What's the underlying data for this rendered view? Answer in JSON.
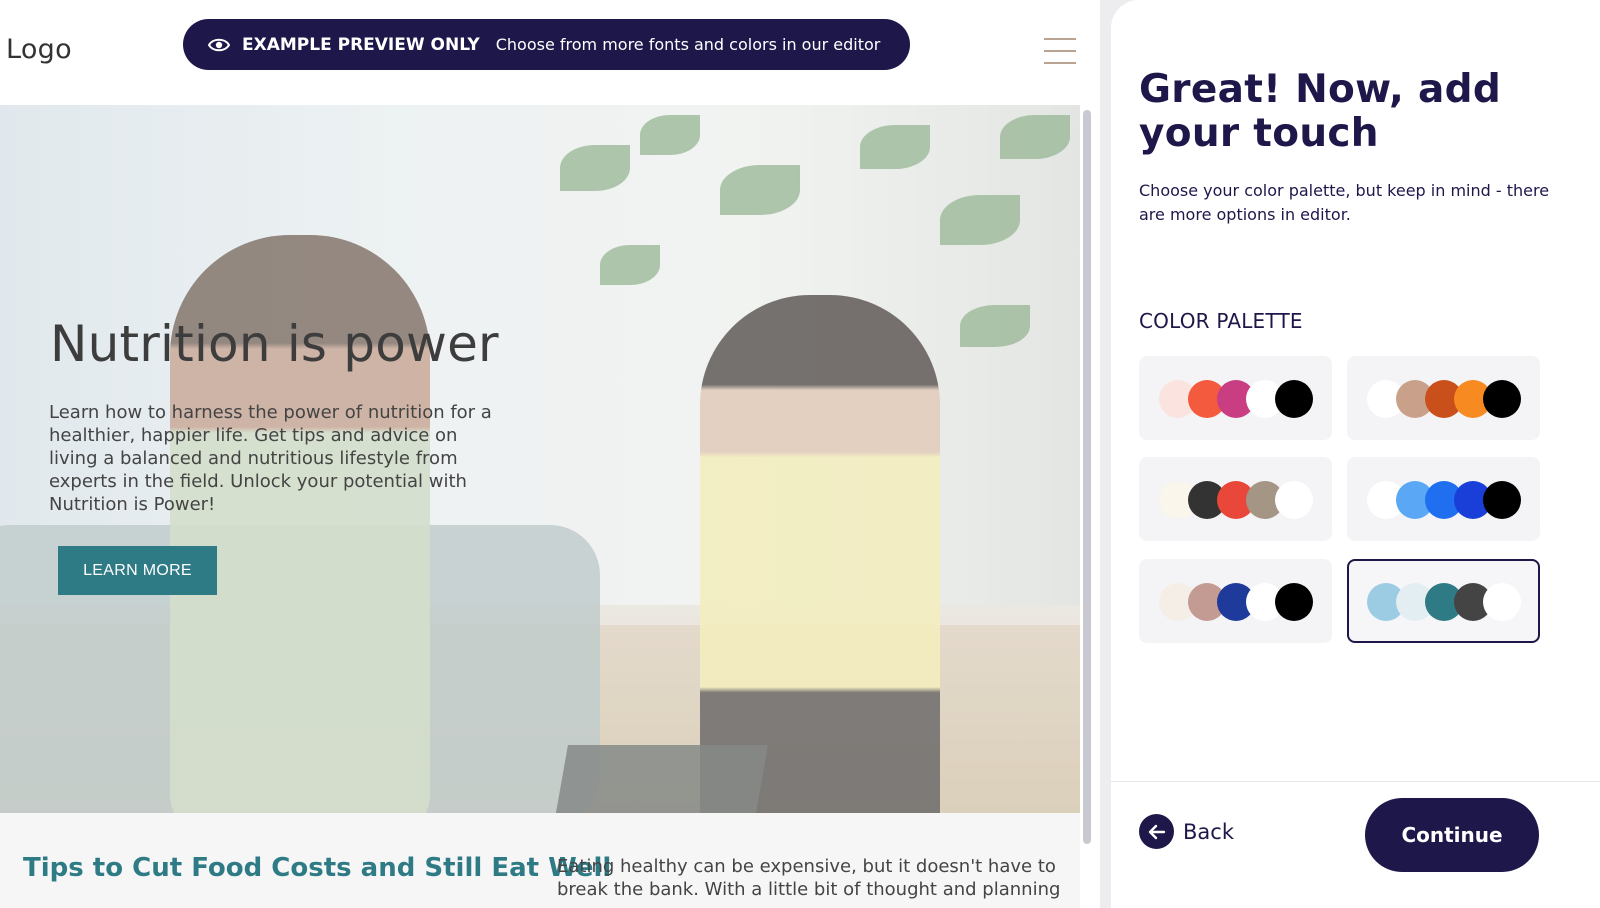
{
  "preview": {
    "logo": "Logo",
    "banner": {
      "icon": "eye-icon",
      "bold_text": "EXAMPLE PREVIEW ONLY",
      "text": "Choose from more fonts and colors in our editor"
    },
    "menu_icon": "hamburger-menu-icon",
    "hero": {
      "title": "Nutrition is power",
      "text": "Learn how to harness the power of nutrition for a healthier, happier life. Get tips and advice on living a balanced and nutritious lifestyle from experts in the field. Unlock your potential with Nutrition is Power!",
      "button_label": "LEARN MORE"
    },
    "section": {
      "title": "Tips to Cut Food Costs and Still Eat Well",
      "text": "Eating healthy can be expensive, but it doesn't have to break the bank. With a little bit of thought and planning"
    },
    "colors": {
      "banner": "#1e174a",
      "accent": "#2e7b86"
    }
  },
  "panel": {
    "title": "Great! Now, add your touch",
    "subtitle": "Choose your color palette, but keep in mind - there are more options in editor.",
    "palette_label": "COLOR PALETTE",
    "palettes": [
      {
        "colors": [
          "#fbe3df",
          "#f45a3d",
          "#c93d82",
          "#ffffff",
          "#000000"
        ],
        "selected": false
      },
      {
        "colors": [
          "#ffffff",
          "#c9a08a",
          "#c9501a",
          "#f88a22",
          "#000000"
        ],
        "selected": false
      },
      {
        "colors": [
          "#fbf6ec",
          "#333333",
          "#e9473a",
          "#a59584",
          "#ffffff"
        ],
        "selected": false
      },
      {
        "colors": [
          "#ffffff",
          "#5aa8f5",
          "#1f6ff0",
          "#1a3fd9",
          "#000000"
        ],
        "selected": false
      },
      {
        "colors": [
          "#f5eee6",
          "#c39b93",
          "#1e3a9a",
          "#ffffff",
          "#000000"
        ],
        "selected": false
      },
      {
        "colors": [
          "#9ccbe4",
          "#e3eef2",
          "#2e7b86",
          "#444444",
          "#ffffff"
        ],
        "selected": true
      }
    ],
    "back_label": "Back",
    "back_icon": "arrow-left-icon",
    "continue_label": "Continue",
    "colors": {
      "primary": "#1e174a"
    }
  }
}
